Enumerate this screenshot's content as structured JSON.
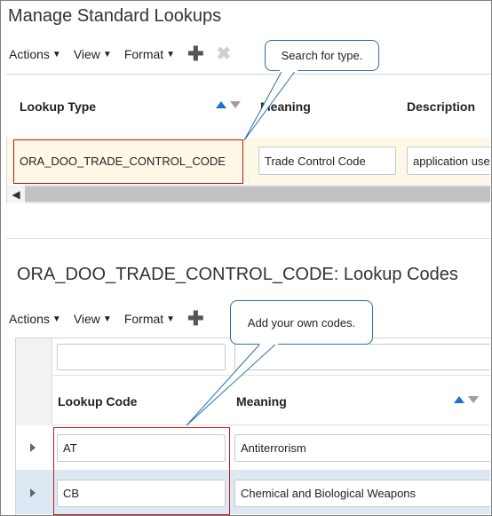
{
  "page_title": "Manage Standard Lookups",
  "toolbar_top": {
    "actions_label": "Actions",
    "view_label": "View",
    "format_label": "Format"
  },
  "callout_top": {
    "text": "Search for type."
  },
  "lookups_table": {
    "headers": {
      "lookup_type": "Lookup Type",
      "meaning": "Meaning",
      "description": "Description"
    },
    "row": {
      "lookup_type": "ORA_DOO_TRADE_CONTROL_CODE",
      "meaning": "Trade Control Code",
      "description": "application use"
    }
  },
  "section_title": "ORA_DOO_TRADE_CONTROL_CODE: Lookup Codes",
  "toolbar_bottom": {
    "actions_label": "Actions",
    "view_label": "View",
    "format_label": "Format"
  },
  "callout_bottom": {
    "text": "Add your own codes."
  },
  "codes_table": {
    "headers": {
      "lookup_code": "Lookup Code",
      "meaning": "Meaning"
    },
    "rows": [
      {
        "code": "AT",
        "meaning": "Antiterrorism"
      },
      {
        "code": "CB",
        "meaning": "Chemical and Biological Weapons"
      }
    ]
  },
  "colors": {
    "selected_row": "#fdf9e6",
    "highlight_row": "#dce9f5",
    "sort_active": "#1a73c9",
    "red_outline": "#c01818"
  }
}
